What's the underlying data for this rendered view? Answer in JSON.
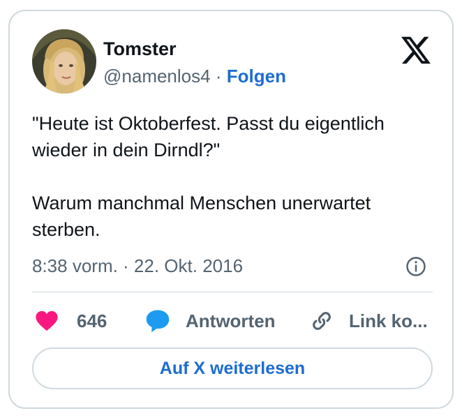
{
  "author": {
    "name": "Tomster",
    "handle": "@namenlos4",
    "separator": "·",
    "follow_label": "Folgen"
  },
  "brand_icon": "x-logo-icon",
  "tweet": {
    "text": "\"Heute ist Oktoberfest. Passt du eigentlich wieder in dein Dirndl?\"\n\nWarum manchmal Menschen unerwartet sterben.",
    "timestamp": "8:38 vorm. · 22. Okt. 2016"
  },
  "actions": {
    "like_count": "646",
    "reply_label": "Antworten",
    "copy_link_label": "Link ko..."
  },
  "read_more_label": "Auf X weiterlesen",
  "colors": {
    "link_blue": "#1d6dd1",
    "like_pink": "#f91880",
    "reply_blue": "#1d9bf0",
    "muted_text": "#536471",
    "border": "#cfd9de"
  }
}
